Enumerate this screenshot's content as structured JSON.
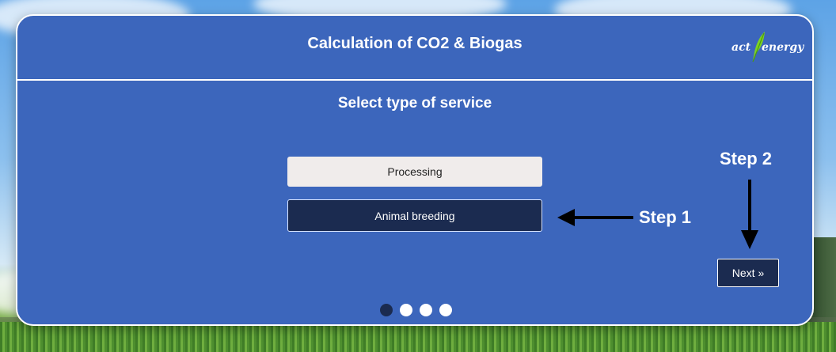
{
  "card": {
    "title": "Calculation of CO2 & Biogas",
    "logo": {
      "text_left": "act",
      "text_right": "energy",
      "icon": "leaf-icon"
    },
    "subtitle": "Select type of service",
    "options": [
      {
        "label": "Processing",
        "selected": false
      },
      {
        "label": "Animal breeding",
        "selected": true
      }
    ],
    "next_label": "Next »",
    "pagination": {
      "total": 4,
      "current": 1
    }
  },
  "annotations": {
    "step1": "Step 1",
    "step2": "Step 2"
  },
  "colors": {
    "card_bg": "#3c66bc",
    "selected_bg": "#1b2b50",
    "unselected_bg": "#f0eceb",
    "leaf": "#7ed321"
  }
}
